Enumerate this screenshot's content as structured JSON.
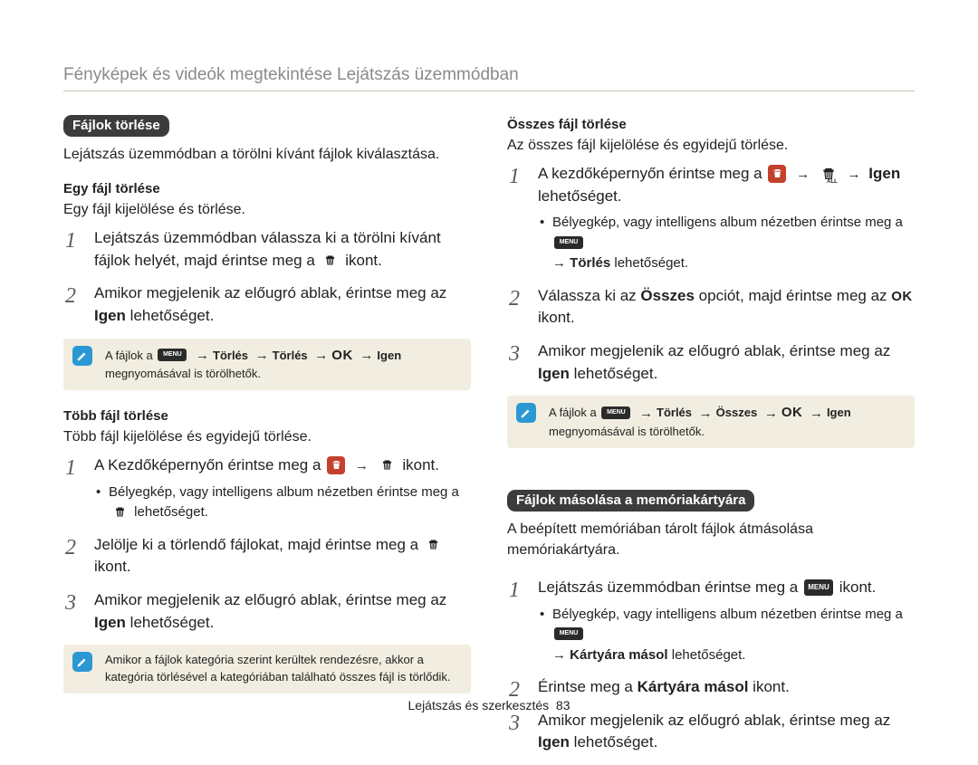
{
  "header": {
    "breadcrumb": "Fényképek és videók megtekintése Lejátszás üzemmódban"
  },
  "left": {
    "pill": "Fájlok törlése",
    "lead": "Lejátszás üzemmódban a törölni kívánt fájlok kiválasztása.",
    "sec1_head": "Egy fájl törlése",
    "sec1_desc": "Egy fájl kijelölése és törlése.",
    "sec1_step1": "Lejátszás üzemmódban válassza ki a törölni kívánt fájlok helyét, majd érintse meg a ",
    "sec1_step1_tail": " ikont.",
    "sec1_step2_a": "Amikor megjelenik az előugró ablak, érintse meg az ",
    "sec1_step2_bold": "Igen",
    "sec1_step2_b": " lehetőséget.",
    "note1_a": "A fájlok a ",
    "note1_chain_1": "Törlés",
    "note1_chain_2": "Törlés",
    "note1_chain_ok": "OK",
    "note1_chain_3": "Igen",
    "note1_tail": " megnyomásával is törölhetők.",
    "sec2_head": "Több fájl törlése",
    "sec2_desc": "Több fájl kijelölése és egyidejű törlése.",
    "sec2_step1_a": "A Kezdőképernyőn érintse meg a ",
    "sec2_step1_tail": " ikont.",
    "sec2_step1_bullet_a": "Bélyegkép, vagy intelligens album nézetben érintse meg a ",
    "sec2_step1_bullet_b": " lehetőséget.",
    "sec2_step2_a": "Jelölje ki a törlendő fájlokat, majd érintse meg a ",
    "sec2_step2_tail": " ikont.",
    "sec2_step3_a": "Amikor megjelenik az előugró ablak, érintse meg az ",
    "sec2_step3_bold": "Igen",
    "sec2_step3_b": " lehetőséget.",
    "note2": "Amikor a fájlok kategória szerint kerültek rendezésre, akkor a kategória törlésével a kategóriában található összes fájl is törlődik."
  },
  "right": {
    "sec1_head": "Összes fájl törlése",
    "sec1_desc": "Az összes fájl kijelölése és egyidejű törlése.",
    "sec1_step1_a": "A kezdőképernyőn érintse meg a ",
    "sec1_step1_bold": "Igen",
    "sec1_step1_b": " lehetőséget.",
    "sec1_step1_bullet_a": "Bélyegkép, vagy intelligens album nézetben érintse meg a ",
    "sec1_step1_bullet_bold": "Törlés",
    "sec1_step1_bullet_b": " lehetőséget.",
    "sec1_step2_a": "Válassza ki az ",
    "sec1_step2_bold": "Összes",
    "sec1_step2_b": " opciót, majd érintse meg az ",
    "sec1_step2_tail": " ikont.",
    "sec1_step3_a": "Amikor megjelenik az előugró ablak, érintse meg az ",
    "sec1_step3_bold": "Igen",
    "sec1_step3_b": " lehetőséget.",
    "note1_a": "A fájlok a ",
    "note1_chain_1": "Törlés",
    "note1_chain_2": "Összes",
    "note1_chain_ok": "OK",
    "note1_chain_3": "Igen",
    "note1_tail": " megnyomásával is törölhetők.",
    "pill": "Fájlok másolása a memóriakártyára",
    "lead": "A beépített memóriában tárolt fájlok átmásolása memóriakártyára.",
    "sec2_step1_a": "Lejátszás üzemmódban érintse meg a ",
    "sec2_step1_tail": " ikont.",
    "sec2_step1_bullet_a": "Bélyegkép, vagy intelligens album nézetben érintse meg a ",
    "sec2_step1_bullet_bold": "Kártyára másol",
    "sec2_step1_bullet_b": " lehetőséget.",
    "sec2_step2_a": "Érintse meg a ",
    "sec2_step2_bold": "Kártyára másol",
    "sec2_step2_b": " ikont.",
    "sec2_step3_a": "Amikor megjelenik az előugró ablak, érintse meg az ",
    "sec2_step3_bold": "Igen",
    "sec2_step3_b": " lehetőséget."
  },
  "footer": {
    "section": "Lejátszás és szerkesztés",
    "page": "83"
  },
  "labels": {
    "menu": "MENU",
    "arrow": "→",
    "arrow_sub": "→ ",
    "all": "ALL",
    "ok": "OK"
  }
}
